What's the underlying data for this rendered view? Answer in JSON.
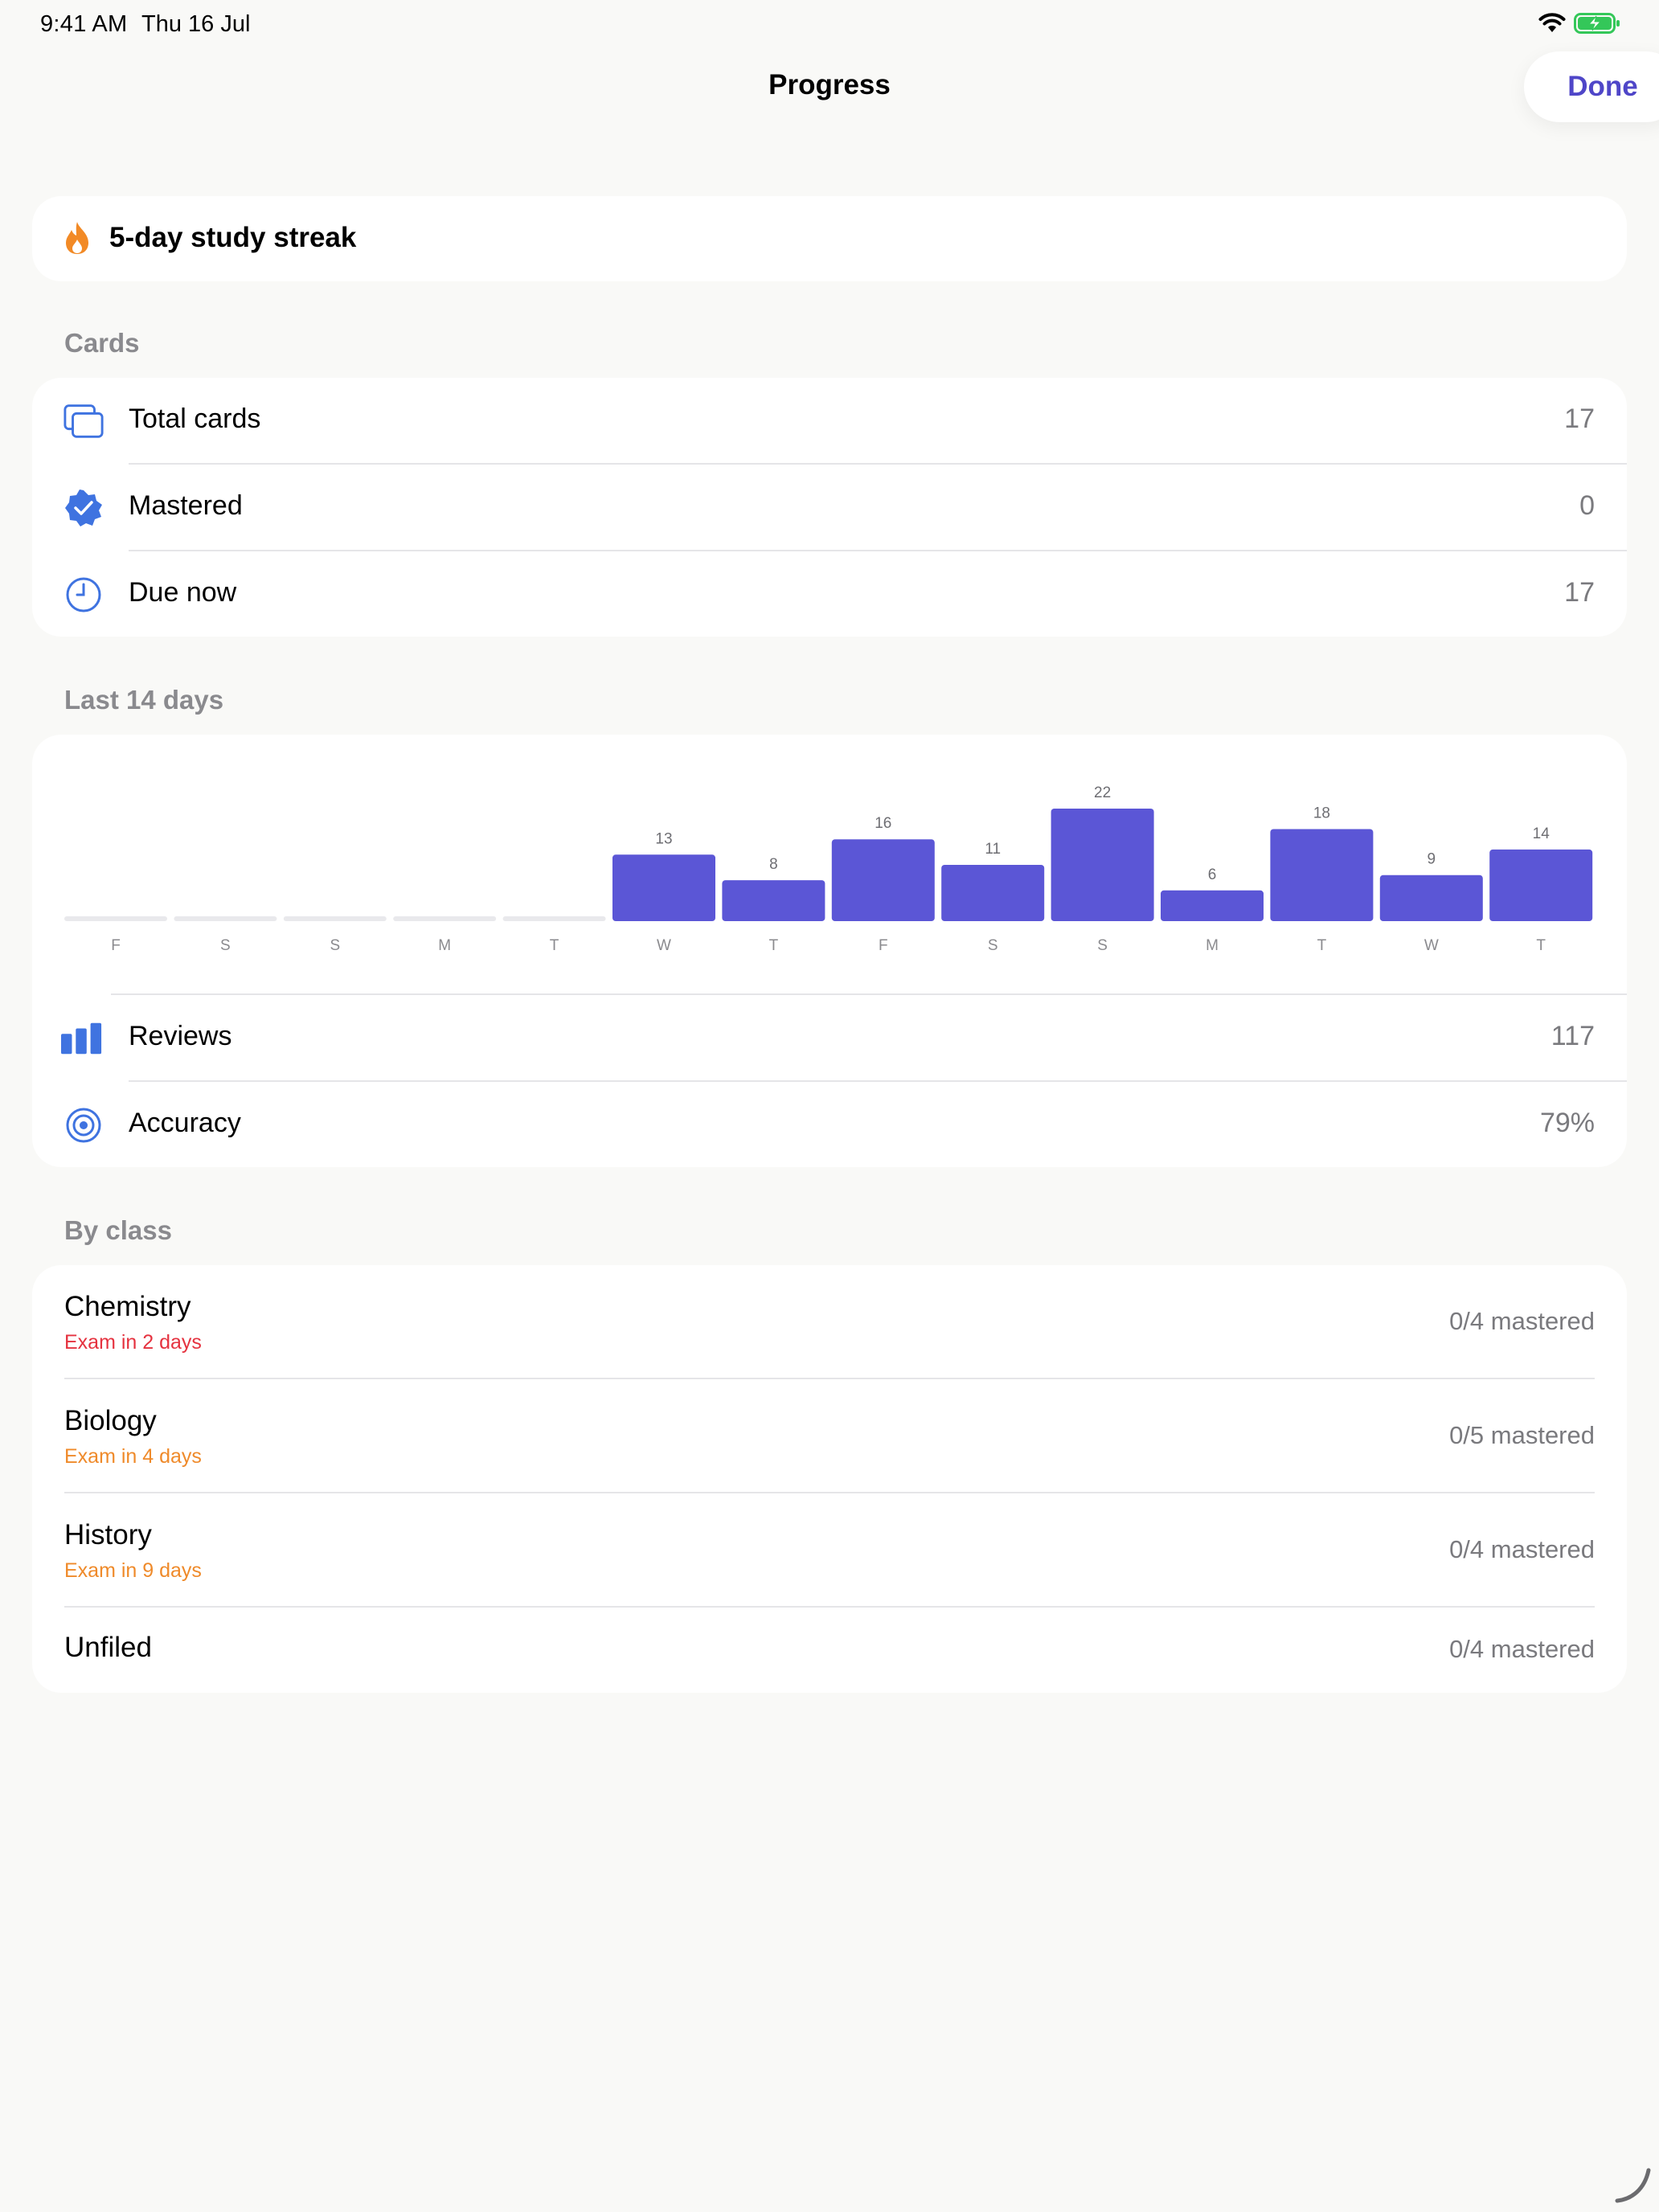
{
  "status": {
    "time": "9:41 AM",
    "date": "Thu 16 Jul"
  },
  "nav": {
    "title": "Progress",
    "done_label": "Done"
  },
  "streak": {
    "text": "5-day study streak"
  },
  "cards_section": {
    "header": "Cards",
    "rows": [
      {
        "label": "Total cards",
        "value": "17",
        "icon": "cards-icon"
      },
      {
        "label": "Mastered",
        "value": "0",
        "icon": "checkmark-seal-icon"
      },
      {
        "label": "Due now",
        "value": "17",
        "icon": "clock-icon"
      }
    ]
  },
  "activity_section": {
    "header": "Last 14 days",
    "stats": [
      {
        "label": "Reviews",
        "value": "117",
        "icon": "bar-chart-icon"
      },
      {
        "label": "Accuracy",
        "value": "79%",
        "icon": "target-icon"
      }
    ]
  },
  "chart_data": {
    "type": "bar",
    "categories": [
      "F",
      "S",
      "S",
      "M",
      "T",
      "W",
      "T",
      "F",
      "S",
      "S",
      "M",
      "T",
      "W",
      "T"
    ],
    "values": [
      0,
      0,
      0,
      0,
      0,
      13,
      8,
      16,
      11,
      22,
      6,
      18,
      9,
      14
    ],
    "value_labels": [
      "",
      "",
      "",
      "",
      "",
      "13",
      "8",
      "16",
      "11",
      "22",
      "6",
      "18",
      "9",
      "14"
    ],
    "ylim": [
      0,
      22
    ],
    "grid": false,
    "bar_color": "#5b56d6",
    "empty_color": "#e9e9ec"
  },
  "class_section": {
    "header": "By class",
    "classes": [
      {
        "name": "Chemistry",
        "exam": "Exam in 2 days",
        "exam_color": "#e5323f",
        "progress": "0/4 mastered"
      },
      {
        "name": "Biology",
        "exam": "Exam in 4 days",
        "exam_color": "#ef8a2a",
        "progress": "0/5 mastered"
      },
      {
        "name": "History",
        "exam": "Exam in 9 days",
        "exam_color": "#ef8a2a",
        "progress": "0/4 mastered"
      },
      {
        "name": "Unfiled",
        "exam": "",
        "exam_color": "",
        "progress": "0/4 mastered"
      }
    ]
  },
  "colors": {
    "accent": "#4f46c8",
    "icon_blue": "#3f73e0",
    "flame": "#f28a26",
    "battery": "#34c759"
  }
}
